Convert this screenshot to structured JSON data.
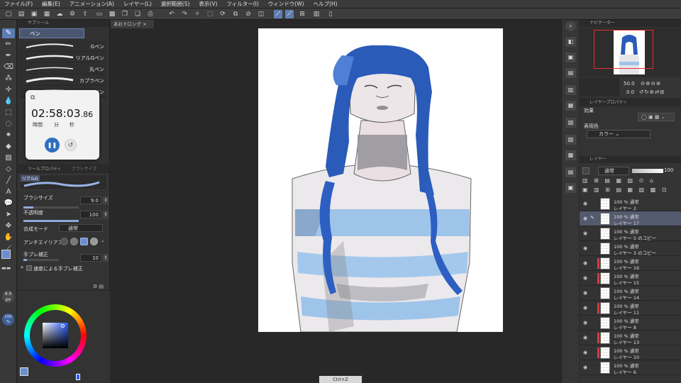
{
  "menu": [
    "ファイル(F)",
    "編集(E)",
    "アニメーション(A)",
    "レイヤー(L)",
    "選択範囲(S)",
    "表示(V)",
    "フィルター(I)",
    "ウィンドウ(W)",
    "ヘルプ(H)"
  ],
  "subtool": {
    "header": "サブツール",
    "group_tab": "ペン",
    "brushes": [
      "Gペン",
      "リアルGペン",
      "丸ペン",
      "カブラペン",
      "ミリペン"
    ]
  },
  "timer": {
    "time_main": "02:58:03",
    "time_frac": ".86",
    "label_h": "時間",
    "label_m": "分",
    "label_s": "秒"
  },
  "tool_property": {
    "header": "ツールプロパティ",
    "header2": "ブラシサイズ",
    "brush_name": "リアルG",
    "size_label": "ブラシサイズ",
    "size_value": "9.0",
    "opacity_label": "不透明度",
    "opacity_value": "100",
    "blend_label": "合成モード",
    "blend_value": "通常",
    "aa_label": "アンチエイリアス",
    "stab_label": "手ブレ補正",
    "stab_value": "10",
    "speed_label": "速度による手ブレ補正"
  },
  "side_indicators": {
    "size": "9.0",
    "size_unit": "px",
    "opacity": "100",
    "opacity_unit": "%"
  },
  "canvas_tab": "あおドロング",
  "navigator": {
    "header": "ナビゲーター",
    "zoom": "50.0",
    "rotate": "0.0"
  },
  "layer_property": {
    "header": "レイヤープロパティ",
    "effect_label": "効果",
    "expr_label": "表現色",
    "expr_value": "カラー"
  },
  "layer_panel": {
    "header": "レイヤー",
    "blend": "通常",
    "opacity": "100",
    "layers": [
      {
        "mode": "100 % 通常",
        "name": "レイヤー 2",
        "selected": false,
        "red": false
      },
      {
        "mode": "100 % 通常",
        "name": "レイヤー 17",
        "selected": true,
        "red": false
      },
      {
        "mode": "100 % 通常",
        "name": "レイヤー 5 のコピー",
        "selected": false,
        "red": false
      },
      {
        "mode": "100 % 通常",
        "name": "レイヤー 3 のコピー",
        "selected": false,
        "red": false
      },
      {
        "mode": "100 % 通常",
        "name": "レイヤー 16",
        "selected": false,
        "red": true
      },
      {
        "mode": "100 % 通常",
        "name": "レイヤー 15",
        "selected": false,
        "red": true
      },
      {
        "mode": "100 % 通常",
        "name": "レイヤー 14",
        "selected": false,
        "red": false
      },
      {
        "mode": "100 % 通常",
        "name": "レイヤー 11",
        "selected": false,
        "red": true
      },
      {
        "mode": "100 % 通常",
        "name": "レイヤー 8",
        "selected": false,
        "red": false
      },
      {
        "mode": "100 % 通常",
        "name": "レイヤー 13",
        "selected": false,
        "red": true
      },
      {
        "mode": "100 % 通常",
        "name": "レイヤー 10",
        "selected": false,
        "red": true
      },
      {
        "mode": "100 % 通常",
        "name": "レイヤー 6",
        "selected": false,
        "red": false
      }
    ]
  },
  "bottom_label": "Ctrl+Z",
  "colors": {
    "accent": "#5b7db5",
    "panel": "#333333",
    "selected_layer": "#545a6e",
    "timer_button": "#2f6fc0"
  }
}
